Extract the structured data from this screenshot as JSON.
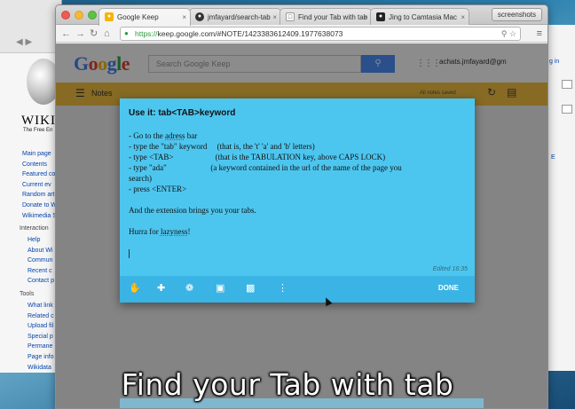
{
  "background_window": {
    "wiki_title": "WIKI",
    "wiki_subtitle": "The Free En",
    "nav_main": [
      "Main page",
      "Contents",
      "Featured co",
      "Current ev",
      "Random art",
      "Donate to W",
      "Wikimedia S"
    ],
    "interaction_heading": "Interaction",
    "nav_interaction": [
      "Help",
      "About Wi",
      "Commun",
      "Recent c",
      "Contact p"
    ],
    "tools_heading": "Tools",
    "nav_tools": [
      "What link",
      "Related c",
      "Upload fil",
      "Special p",
      "Permane",
      "Page info",
      "Wikidata"
    ],
    "right_login": "g in",
    "right_e": "E"
  },
  "browser": {
    "tabs": [
      {
        "label": "Google Keep",
        "icon": "keep-icon",
        "active": true
      },
      {
        "label": "jmfayard/search-tab",
        "icon": "github-icon",
        "active": false
      },
      {
        "label": "Find your Tab with tab",
        "icon": "tab-icon",
        "active": false
      },
      {
        "label": "Jing to Camtasia Mac",
        "icon": "jing-icon",
        "active": false
      }
    ],
    "extension_button": "screenshots",
    "url_scheme": "https://",
    "url_rest": "keep.google.com/#NOTE/1423383612409.1977638073"
  },
  "keep": {
    "logo": [
      "G",
      "o",
      "o",
      "g",
      "l",
      "e"
    ],
    "search_placeholder": "Search Google Keep",
    "account": "achats.jmfayard@gm",
    "bar_title": "Notes",
    "saved_text": "All notes saved",
    "note": {
      "title": "Use it: tab<TAB>keyword",
      "lines": [
        "- Go to the ",
        "adress",
        " bar",
        "- type the \"tab\" keyword     (that is, the 't' 'a' and 'b' letters)",
        "- type <TAB>                     (that is the TABULATION key, above CAPS LOCK)",
        "- type \"ada\"                      (a keyword contained in the url of the name of the page you",
        "search)",
        "- press <ENTER>",
        "And the extension brings you your tabs.",
        "Hurra for ",
        "lazyness",
        "!"
      ],
      "edited": "Edited 16:35",
      "done_label": "DONE"
    }
  },
  "caption": "Find your Tab with tab"
}
